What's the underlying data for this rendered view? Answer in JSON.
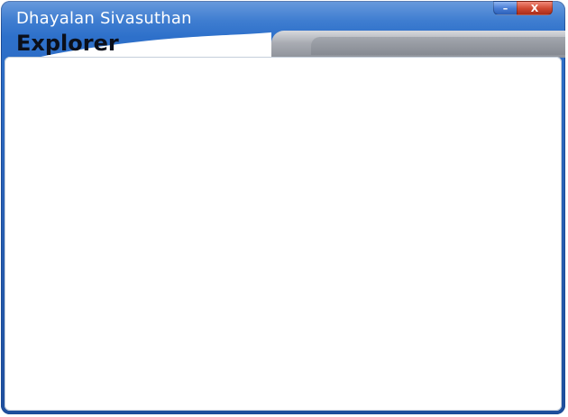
{
  "window": {
    "subtitle": "Dhayalan Sivasuthan",
    "title": "Explorer"
  },
  "controls": {
    "minimize_label": "–",
    "close_label": "X"
  },
  "colors": {
    "header_blue": "#2a63b8",
    "close_red": "#d14b32",
    "content_bg": "#ffffff"
  },
  "icons": {
    "minimize": "minimize-icon",
    "close": "close-icon"
  }
}
